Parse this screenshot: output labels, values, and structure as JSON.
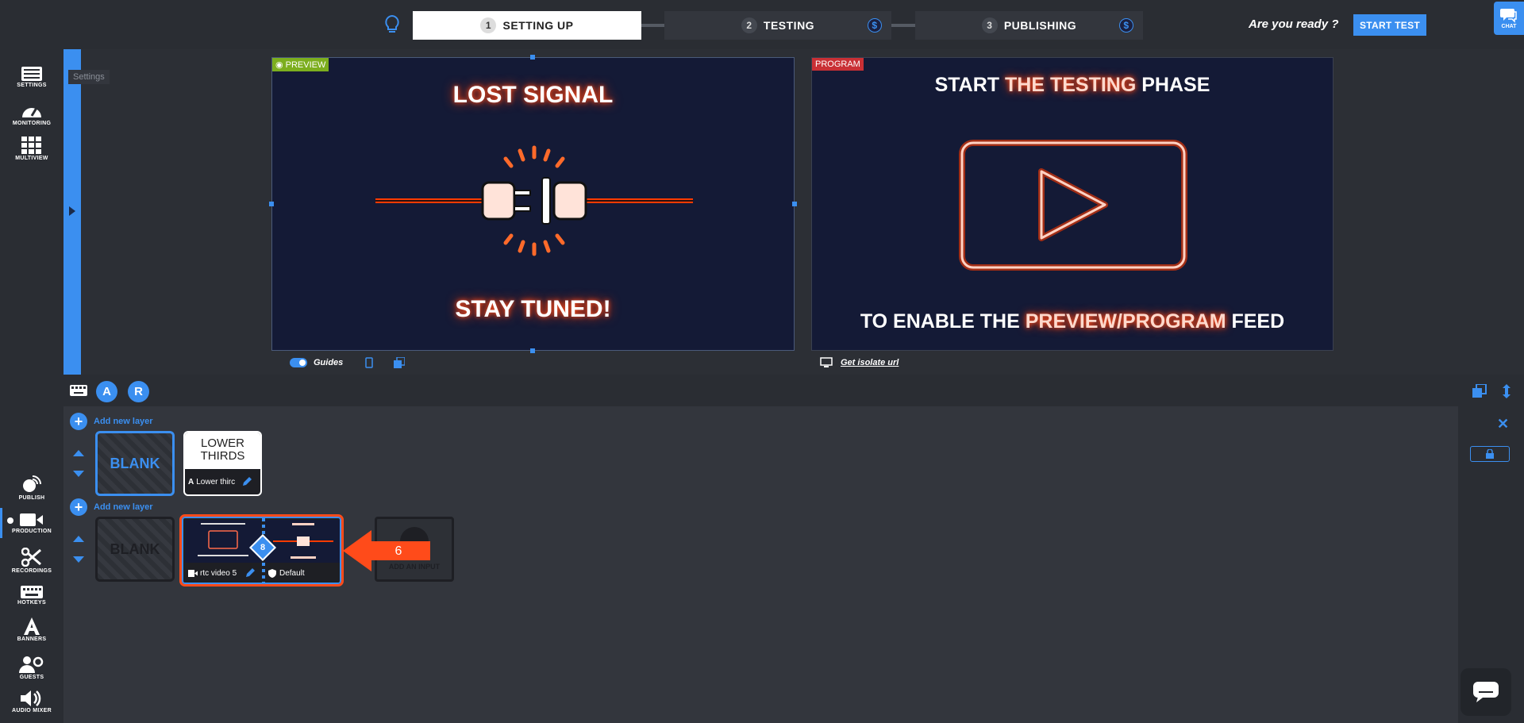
{
  "steps": [
    {
      "num": "1",
      "label": "SETTING UP"
    },
    {
      "num": "2",
      "label": "TESTING",
      "badge": "$"
    },
    {
      "num": "3",
      "label": "PUBLISHING",
      "badge": "$"
    }
  ],
  "header": {
    "ready_text": "Are you ready ?",
    "start_test": "START TEST",
    "chat_label": "CHAT"
  },
  "sidebar": {
    "items": [
      {
        "label": "SETTINGS",
        "icon": "settings-icon"
      },
      {
        "label": "MONITORING",
        "icon": "gauge-icon"
      },
      {
        "label": "MULTIVIEW",
        "icon": "grid-icon"
      },
      {
        "label": "PUBLISH",
        "icon": "satellite-icon"
      },
      {
        "label": "PRODUCTION",
        "icon": "camera-icon"
      },
      {
        "label": "RECORDINGS",
        "icon": "scissors-icon"
      },
      {
        "label": "HOTKEYS",
        "icon": "keyboard-icon"
      },
      {
        "label": "BANNERS",
        "icon": "letter-a-icon"
      },
      {
        "label": "GUESTS",
        "icon": "guests-icon"
      },
      {
        "label": "AUDIO MIXER",
        "icon": "speaker-icon"
      }
    ],
    "tooltip": "Settings"
  },
  "preview": {
    "tag": "PREVIEW",
    "title": "LOST SIGNAL",
    "subtitle": "STAY TUNED!",
    "guides_label": "Guides"
  },
  "program": {
    "tag": "PROGRAM",
    "line1_a": "START ",
    "line1_hl": "THE TESTING",
    "line1_b": " PHASE",
    "line2_a": "TO ENABLE THE ",
    "line2_hl": "PREVIEW/PROGRAM",
    "line2_b": " FEED",
    "isolate_label": "Get isolate url"
  },
  "layers": {
    "btn_a": "A",
    "btn_r": "R",
    "add_layer": "Add new layer",
    "blank_label": "BLANK",
    "lower_thirds_title_1": "LOWER",
    "lower_thirds_title_2": "THIRDS",
    "lower_thirds_name": "Lower thirc",
    "input_name": "rtc video 5",
    "input_profile": "Default",
    "badge_num": "8",
    "step_marker": "6",
    "add_input_label": "ADD AN INPUT"
  },
  "colors": {
    "accent": "#3b8ff0",
    "preview_tag": "#7cae1e",
    "program_tag": "#c93035",
    "neon": "#ff3b00",
    "pointer": "#ff4b1a"
  }
}
